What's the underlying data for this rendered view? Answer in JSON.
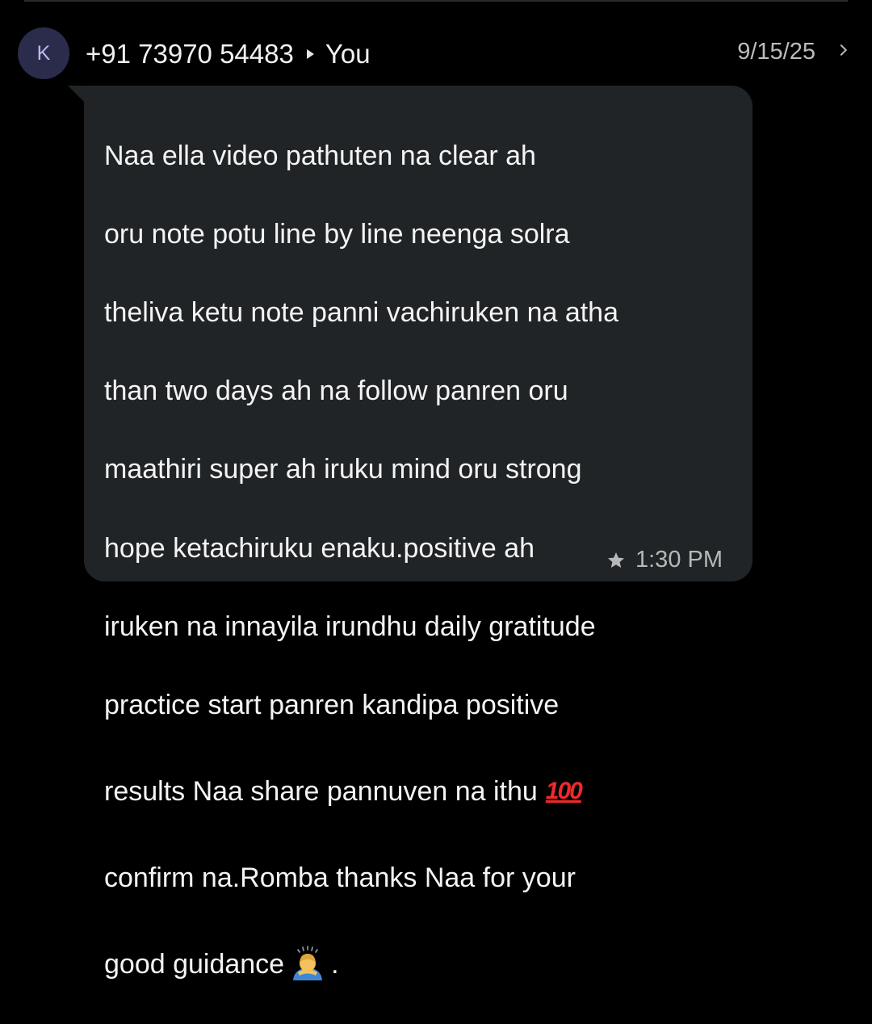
{
  "header": {
    "avatar_letter": "K",
    "sender": "+91 73970 54483",
    "recipient": "You",
    "date": "9/15/25"
  },
  "message": {
    "lines": [
      "Naa ella video pathuten na  clear ah",
      "oru note potu line by line neenga solra",
      "theliva ketu note panni vachiruken na atha",
      "than two days ah na follow panren oru",
      "maathiri super ah iruku mind oru strong",
      "hope ketachiruku enaku.positive ah",
      "iruken na innayila irundhu daily gratitude",
      "practice start  panren kandipa positive",
      "results Naa share pannuven na ithu",
      "confirm na.Romba thanks Naa for your",
      "good guidance"
    ],
    "emoji_hundred_text": "100",
    "trailing_dot": ".",
    "time": "1:30 PM"
  },
  "icons": {
    "send_arrow": "arrow-right-icon",
    "chevron": "chevron-right-icon",
    "star": "star-icon",
    "emoji_1": "hundred-points-emoji",
    "emoji_2": "person-bowing-emoji"
  },
  "colors": {
    "background": "#000000",
    "bubble": "#202426",
    "avatar_bg": "#2b2c4b",
    "avatar_text": "#b9b9f2",
    "secondary_text": "#bcbcbc"
  }
}
